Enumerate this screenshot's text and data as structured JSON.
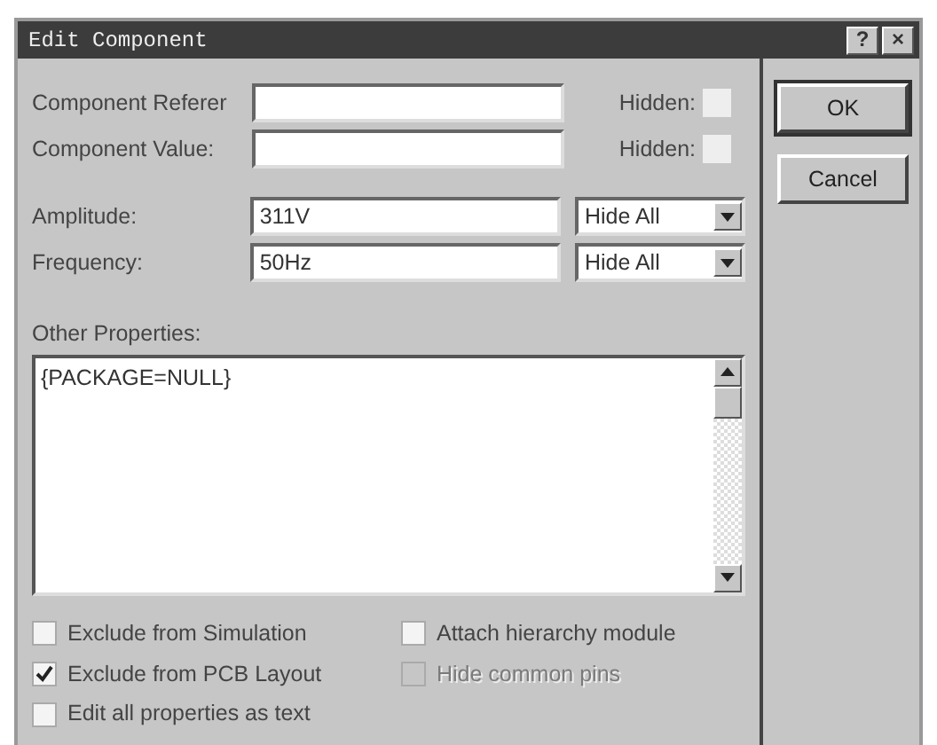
{
  "window": {
    "title": "Edit Component",
    "help_button": "?",
    "close_button": "×"
  },
  "name_fields": [
    {
      "label": "Component Referer",
      "hidden_label": "Hidden:",
      "hidden": false
    },
    {
      "label": "Component Value:",
      "hidden_label": "Hidden:",
      "hidden": false
    }
  ],
  "parameters": [
    {
      "label": "Amplitude:",
      "value": "311V",
      "visibility": "Hide All"
    },
    {
      "label": "Frequency:",
      "value": "50Hz",
      "visibility": "Hide All"
    }
  ],
  "other_properties": {
    "label": "Other Properties:",
    "text": "{PACKAGE=NULL}"
  },
  "options": [
    {
      "label": "Exclude from Simulation",
      "checked": false,
      "disabled": false
    },
    {
      "label": "Attach hierarchy module",
      "checked": false,
      "disabled": false
    },
    {
      "label": "Exclude from PCB Layout",
      "checked": true,
      "disabled": false
    },
    {
      "label": "Hide common pins",
      "checked": false,
      "disabled": true
    },
    {
      "label": "Edit all properties as text",
      "checked": false,
      "disabled": false
    }
  ],
  "buttons": [
    {
      "label": "OK",
      "default": true
    },
    {
      "label": "Cancel",
      "default": false
    }
  ]
}
